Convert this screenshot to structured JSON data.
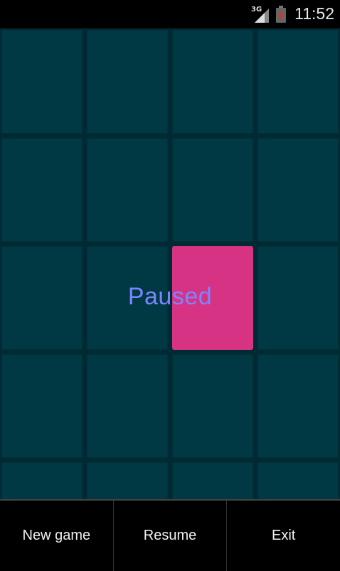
{
  "status_bar": {
    "network": "3G",
    "time": "11:52"
  },
  "game": {
    "status_text": "Paused",
    "tile_color": "#003844",
    "active_tile_color": "#d63384",
    "text_color": "#7a86ff"
  },
  "menu": {
    "new_game": "New game",
    "resume": "Resume",
    "exit": "Exit"
  }
}
